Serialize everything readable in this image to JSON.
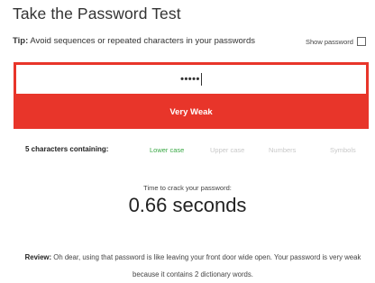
{
  "title": "Take the Password Test",
  "tip": {
    "label": "Tip:",
    "text": "Avoid sequences or repeated characters in your passwords"
  },
  "show_password": {
    "label": "Show password",
    "checked": false
  },
  "password": {
    "masked_value": "•••••"
  },
  "strength": {
    "label": "Very Weak",
    "color": "#e8352a"
  },
  "criteria": {
    "count_label": "5 characters containing:",
    "items": [
      {
        "label": "Lower case",
        "active": true
      },
      {
        "label": "Upper case",
        "active": false
      },
      {
        "label": "Numbers",
        "active": false
      },
      {
        "label": "Symbols",
        "active": false
      }
    ],
    "active_color": "#3aa845",
    "inactive_color": "#c8c8c8"
  },
  "crack": {
    "label": "Time to crack your password:",
    "time": "0.66 seconds"
  },
  "review": {
    "label": "Review:",
    "text": "Oh dear, using that password is like leaving your front door wide open. Your password is very weak because it contains 2 dictionary words."
  }
}
